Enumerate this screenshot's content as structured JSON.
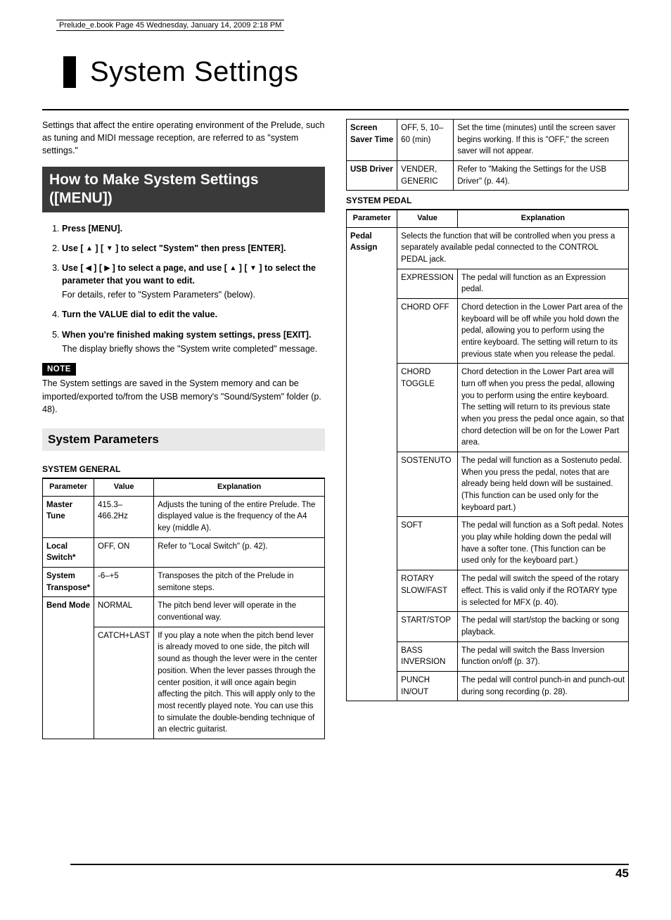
{
  "header_note": "Prelude_e.book  Page 45  Wednesday, January 14, 2009  2:18 PM",
  "title": "System Settings",
  "intro": "Settings that affect the entire operating environment of the Prelude, such as tuning and MIDI message reception, are referred to as \"system settings.\"",
  "section_dark": "How to Make System Settings ([MENU])",
  "steps": [
    {
      "bold": "Press [MENU]."
    },
    {
      "bold_pre": "Use [ ",
      "icon1": "▲",
      "bold_mid": " ] [ ",
      "icon2": "▼",
      "bold_post": " ] to select \"System\" then press [ENTER]."
    },
    {
      "bold_pre": "Use [ ",
      "icon1": "◀",
      "bold_mid": " ] [ ",
      "icon2": "▶",
      "bold_mid2": " ] to select a page, and use [ ",
      "icon3": "▲",
      "bold_mid3": " ] [ ",
      "icon4": "▼",
      "bold_post": " ] to select the parameter that you want to edit.",
      "sub": "For details, refer to \"System Parameters\" (below)."
    },
    {
      "bold": "Turn the VALUE dial to edit the value."
    },
    {
      "bold": "When you're finished making system settings, press [EXIT].",
      "sub": "The display briefly shows the \"System write completed\" message."
    }
  ],
  "note_label": "NOTE",
  "note_text": "The System settings are saved in the System memory and can be imported/exported to/from the USB memory's \"Sound/System\" folder (p. 48).",
  "subhead": "System Parameters",
  "table1_title": "SYSTEM GENERAL",
  "headers": {
    "param": "Parameter",
    "value": "Value",
    "expl": "Explanation"
  },
  "table1": [
    {
      "param": "Master Tune",
      "value": "415.3–466.2Hz",
      "expl": "Adjusts the tuning of the entire Prelude. The displayed value is the frequency of the A4 key (middle A)."
    },
    {
      "param": "Local Switch*",
      "value": "OFF, ON",
      "expl": "Refer to \"Local Switch\" (p. 42)."
    },
    {
      "param": "System Transpose*",
      "value": "-6–+5",
      "expl": "Transposes the pitch of the Prelude in semitone steps."
    },
    {
      "param": "Bend Mode",
      "rows": [
        {
          "value": "NORMAL",
          "expl": "The pitch bend lever will operate in the conventional way."
        },
        {
          "value": "CATCH+LAST",
          "expl": "If you play a note when the pitch bend lever is already moved to one side, the pitch will sound as though the lever were in the center position. When the lever passes through the center position, it will once again begin affecting the pitch. This will apply only to the most recently played note. You can use this to simulate the double-bending technique of an electric guitarist."
        }
      ]
    }
  ],
  "table_right_extra": [
    {
      "param": "Screen Saver Time",
      "value": "OFF, 5, 10–60 (min)",
      "expl": "Set the time (minutes) until the screen saver begins working. If this is \"OFF,\" the screen saver will not appear."
    },
    {
      "param": "USB Driver",
      "value": "VENDER, GENERIC",
      "expl": "Refer to \"Making the Settings for the USB Driver\" (p. 44)."
    }
  ],
  "table2_title": "SYSTEM PEDAL",
  "table2_intro": "Selects the function that will be controlled when you press a separately available pedal connected to the CONTROL PEDAL jack.",
  "table2_param": "Pedal Assign",
  "table2_rows": [
    {
      "value": "EXPRESSION",
      "expl": "The pedal will function as an Expression pedal."
    },
    {
      "value": "CHORD OFF",
      "expl": "Chord detection in the Lower Part area of the keyboard will be off while you hold down the pedal, allowing you to perform using the entire keyboard. The setting will return to its previous state when you release the pedal."
    },
    {
      "value": "CHORD TOGGLE",
      "expl": "Chord detection in the Lower Part area will turn off when you press the pedal, allowing you to perform using the entire keyboard. The setting will return to its previous state when you press the pedal once again, so that chord detection will be on for the Lower Part area."
    },
    {
      "value": "SOSTENUTO",
      "expl": "The pedal will function as a Sostenuto pedal. When you press the pedal, notes that are already being held down will be sustained. (This function can be used only for the keyboard part.)"
    },
    {
      "value": "SOFT",
      "expl": "The pedal will function as a Soft pedal. Notes you play while holding down the pedal will have a softer tone. (This function can be used only for the keyboard part.)"
    },
    {
      "value": "ROTARY SLOW/FAST",
      "expl": "The pedal will switch the speed of the rotary effect. This is valid only if the ROTARY type is selected for MFX (p. 40)."
    },
    {
      "value": "START/STOP",
      "expl": "The pedal will start/stop the backing or song playback."
    },
    {
      "value": "BASS INVERSION",
      "expl": "The pedal will switch the Bass Inversion function on/off (p. 37)."
    },
    {
      "value": "PUNCH IN/OUT",
      "expl": "The pedal will control punch-in and punch-out during song recording (p. 28)."
    }
  ],
  "page_number": "45"
}
